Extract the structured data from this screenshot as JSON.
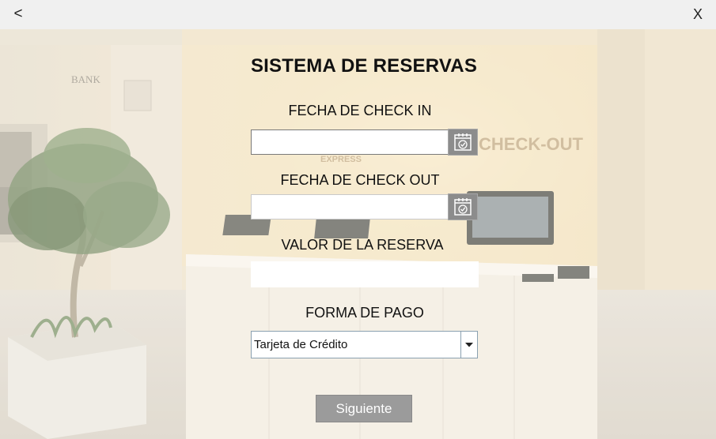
{
  "window": {
    "back_label": "<",
    "close_label": "X"
  },
  "form": {
    "title": "SISTEMA DE RESERVAS",
    "checkin_label": "FECHA DE CHECK IN",
    "checkin_value": "",
    "checkout_label": "FECHA DE CHECK OUT",
    "checkout_value": "",
    "amount_label": "VALOR DE LA RESERVA",
    "amount_value": "",
    "payment_label": "FORMA DE PAGO",
    "payment_selected": "Tarjeta de Crédito",
    "next_label": "Siguiente"
  },
  "background": {
    "sign_text": "CHECK-OUT",
    "sign_small": "EXPRESS",
    "wall_text": "BANK"
  },
  "colors": {
    "topbar": "#f0f0f0",
    "button_gray": "#9b9b9b",
    "calendar_button": "#8c8c8c"
  },
  "icons": {
    "calendar": "calendar-check-icon",
    "dropdown": "chevron-down-icon"
  }
}
